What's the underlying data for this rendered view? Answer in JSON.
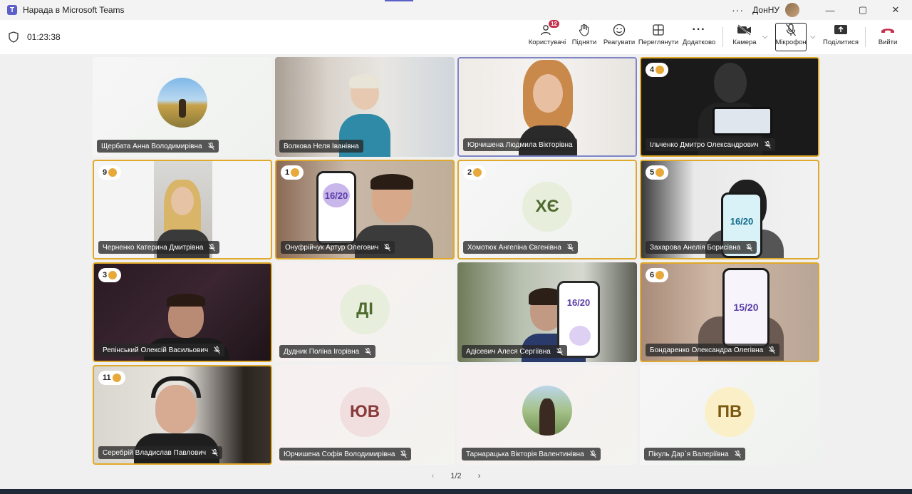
{
  "window": {
    "title": "Нарада в Microsoft Teams",
    "org": "ДонНУ"
  },
  "meeting": {
    "timer": "01:23:38"
  },
  "toolbar": {
    "users": {
      "label": "Користувачі",
      "badge": "12"
    },
    "raise": {
      "label": "Підняти"
    },
    "react": {
      "label": "Реагувати"
    },
    "view": {
      "label": "Переглянути"
    },
    "more": {
      "label": "Додатково"
    },
    "camera": {
      "label": "Камера"
    },
    "mic": {
      "label": "Мікрофон"
    },
    "share": {
      "label": "Поділитися"
    },
    "leave": {
      "label": "Вийти",
      "color": "#c4314b"
    }
  },
  "participants": [
    {
      "name": "Щербата Анна Володимирівна",
      "hand": ""
    },
    {
      "name": "Волкова Неля Іванівна",
      "hand": ""
    },
    {
      "name": "Юрчишена Людмила Вікторівна",
      "hand": ""
    },
    {
      "name": "Ільченко Дмитро Олександрович",
      "hand": "4"
    },
    {
      "name": "Черненко Катерина Дмитрівна",
      "hand": "9"
    },
    {
      "name": "Онуфрійчук Артур Олегович",
      "hand": "1",
      "phone_score": "16/20"
    },
    {
      "name": "Хомотюк Ангеліна Євгенівна",
      "hand": "2",
      "initials": "ХЄ"
    },
    {
      "name": "Захарова Анелія Борисівна",
      "hand": "5",
      "phone_score": "16/20"
    },
    {
      "name": "Репінський Олексій Васильович",
      "hand": "3"
    },
    {
      "name": "Дудник Поліна Ігорівна",
      "hand": "",
      "initials": "ДІ"
    },
    {
      "name": "Адісевич Алеся Сергіївна",
      "hand": "",
      "phone_score": "16/20"
    },
    {
      "name": "Бондаренко Олександра Олегівна",
      "hand": "6",
      "phone_score": "15/20"
    },
    {
      "name": "Серебрій Владислав Павлович",
      "hand": "11"
    },
    {
      "name": "Юрчишена Софія Володимирівна",
      "hand": "",
      "initials": "ЮВ"
    },
    {
      "name": "Тарнарацька Вікторія Валентинівна",
      "hand": ""
    },
    {
      "name": "Пікуль Дар`я Валеріївна",
      "hand": "",
      "initials": "ПВ"
    }
  ],
  "pager": {
    "text": "1/2"
  },
  "colors": {
    "raised_hand_border": "#e0a92a",
    "speaker_border": "#7f85c6",
    "accent": "#5b5fc7"
  }
}
